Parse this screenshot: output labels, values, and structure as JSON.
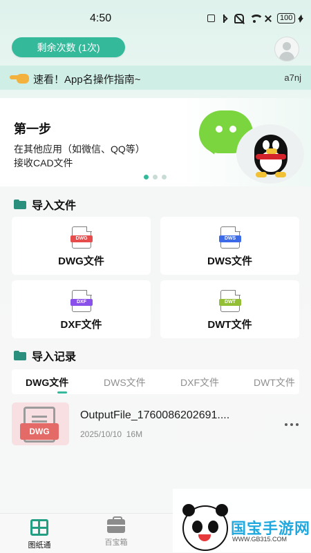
{
  "status_bar": {
    "time": "4:50",
    "battery": "100",
    "icons": [
      "nfc-icon",
      "bluetooth-icon",
      "mute-icon",
      "wifi-icon",
      "no-sim-icon",
      "battery-icon",
      "charging-icon"
    ]
  },
  "header": {
    "remaining_label": "剩余次数 (1次)"
  },
  "guide_banner": {
    "text": "速看！App名操作指南~",
    "code": "a7nj"
  },
  "hero": {
    "step_title": "第一步",
    "line1": "在其他应用（如微信、QQ等）",
    "line2": "接收CAD文件",
    "carousel_total": 3,
    "carousel_active": 1
  },
  "import_section": {
    "title": "导入文件",
    "cards": [
      {
        "label": "DWG文件",
        "tag": "DWG",
        "color": "#e74c4c"
      },
      {
        "label": "DWS文件",
        "tag": "DWS",
        "color": "#3d6be7"
      },
      {
        "label": "DXF文件",
        "tag": "DXF",
        "color": "#8a51ea"
      },
      {
        "label": "DWT文件",
        "tag": "DWT",
        "color": "#92bf35"
      }
    ]
  },
  "records_section": {
    "title": "导入记录",
    "tabs": [
      "DWG文件",
      "DWS文件",
      "DXF文件",
      "DWT文件"
    ],
    "active_tab": 0,
    "records": [
      {
        "thumb_label": "DWG",
        "name": "OutputFile_1760086202691....",
        "date": "2025/10/10",
        "size": "16M"
      }
    ]
  },
  "bottom_nav": {
    "items": [
      {
        "label": "图纸通",
        "icon": "map-grid-icon",
        "active": true
      },
      {
        "label": "百宝箱",
        "icon": "toolbox-icon",
        "active": false
      }
    ]
  },
  "watermark": {
    "brand": "国宝手游网",
    "url": "WWW.GB315.COM"
  },
  "colors": {
    "accent": "#35b99b",
    "banner_bg": "#cfeee6",
    "dwg": "#e74c4c",
    "dws": "#3d6be7",
    "dxf": "#8a51ea",
    "dwt": "#92bf35"
  }
}
